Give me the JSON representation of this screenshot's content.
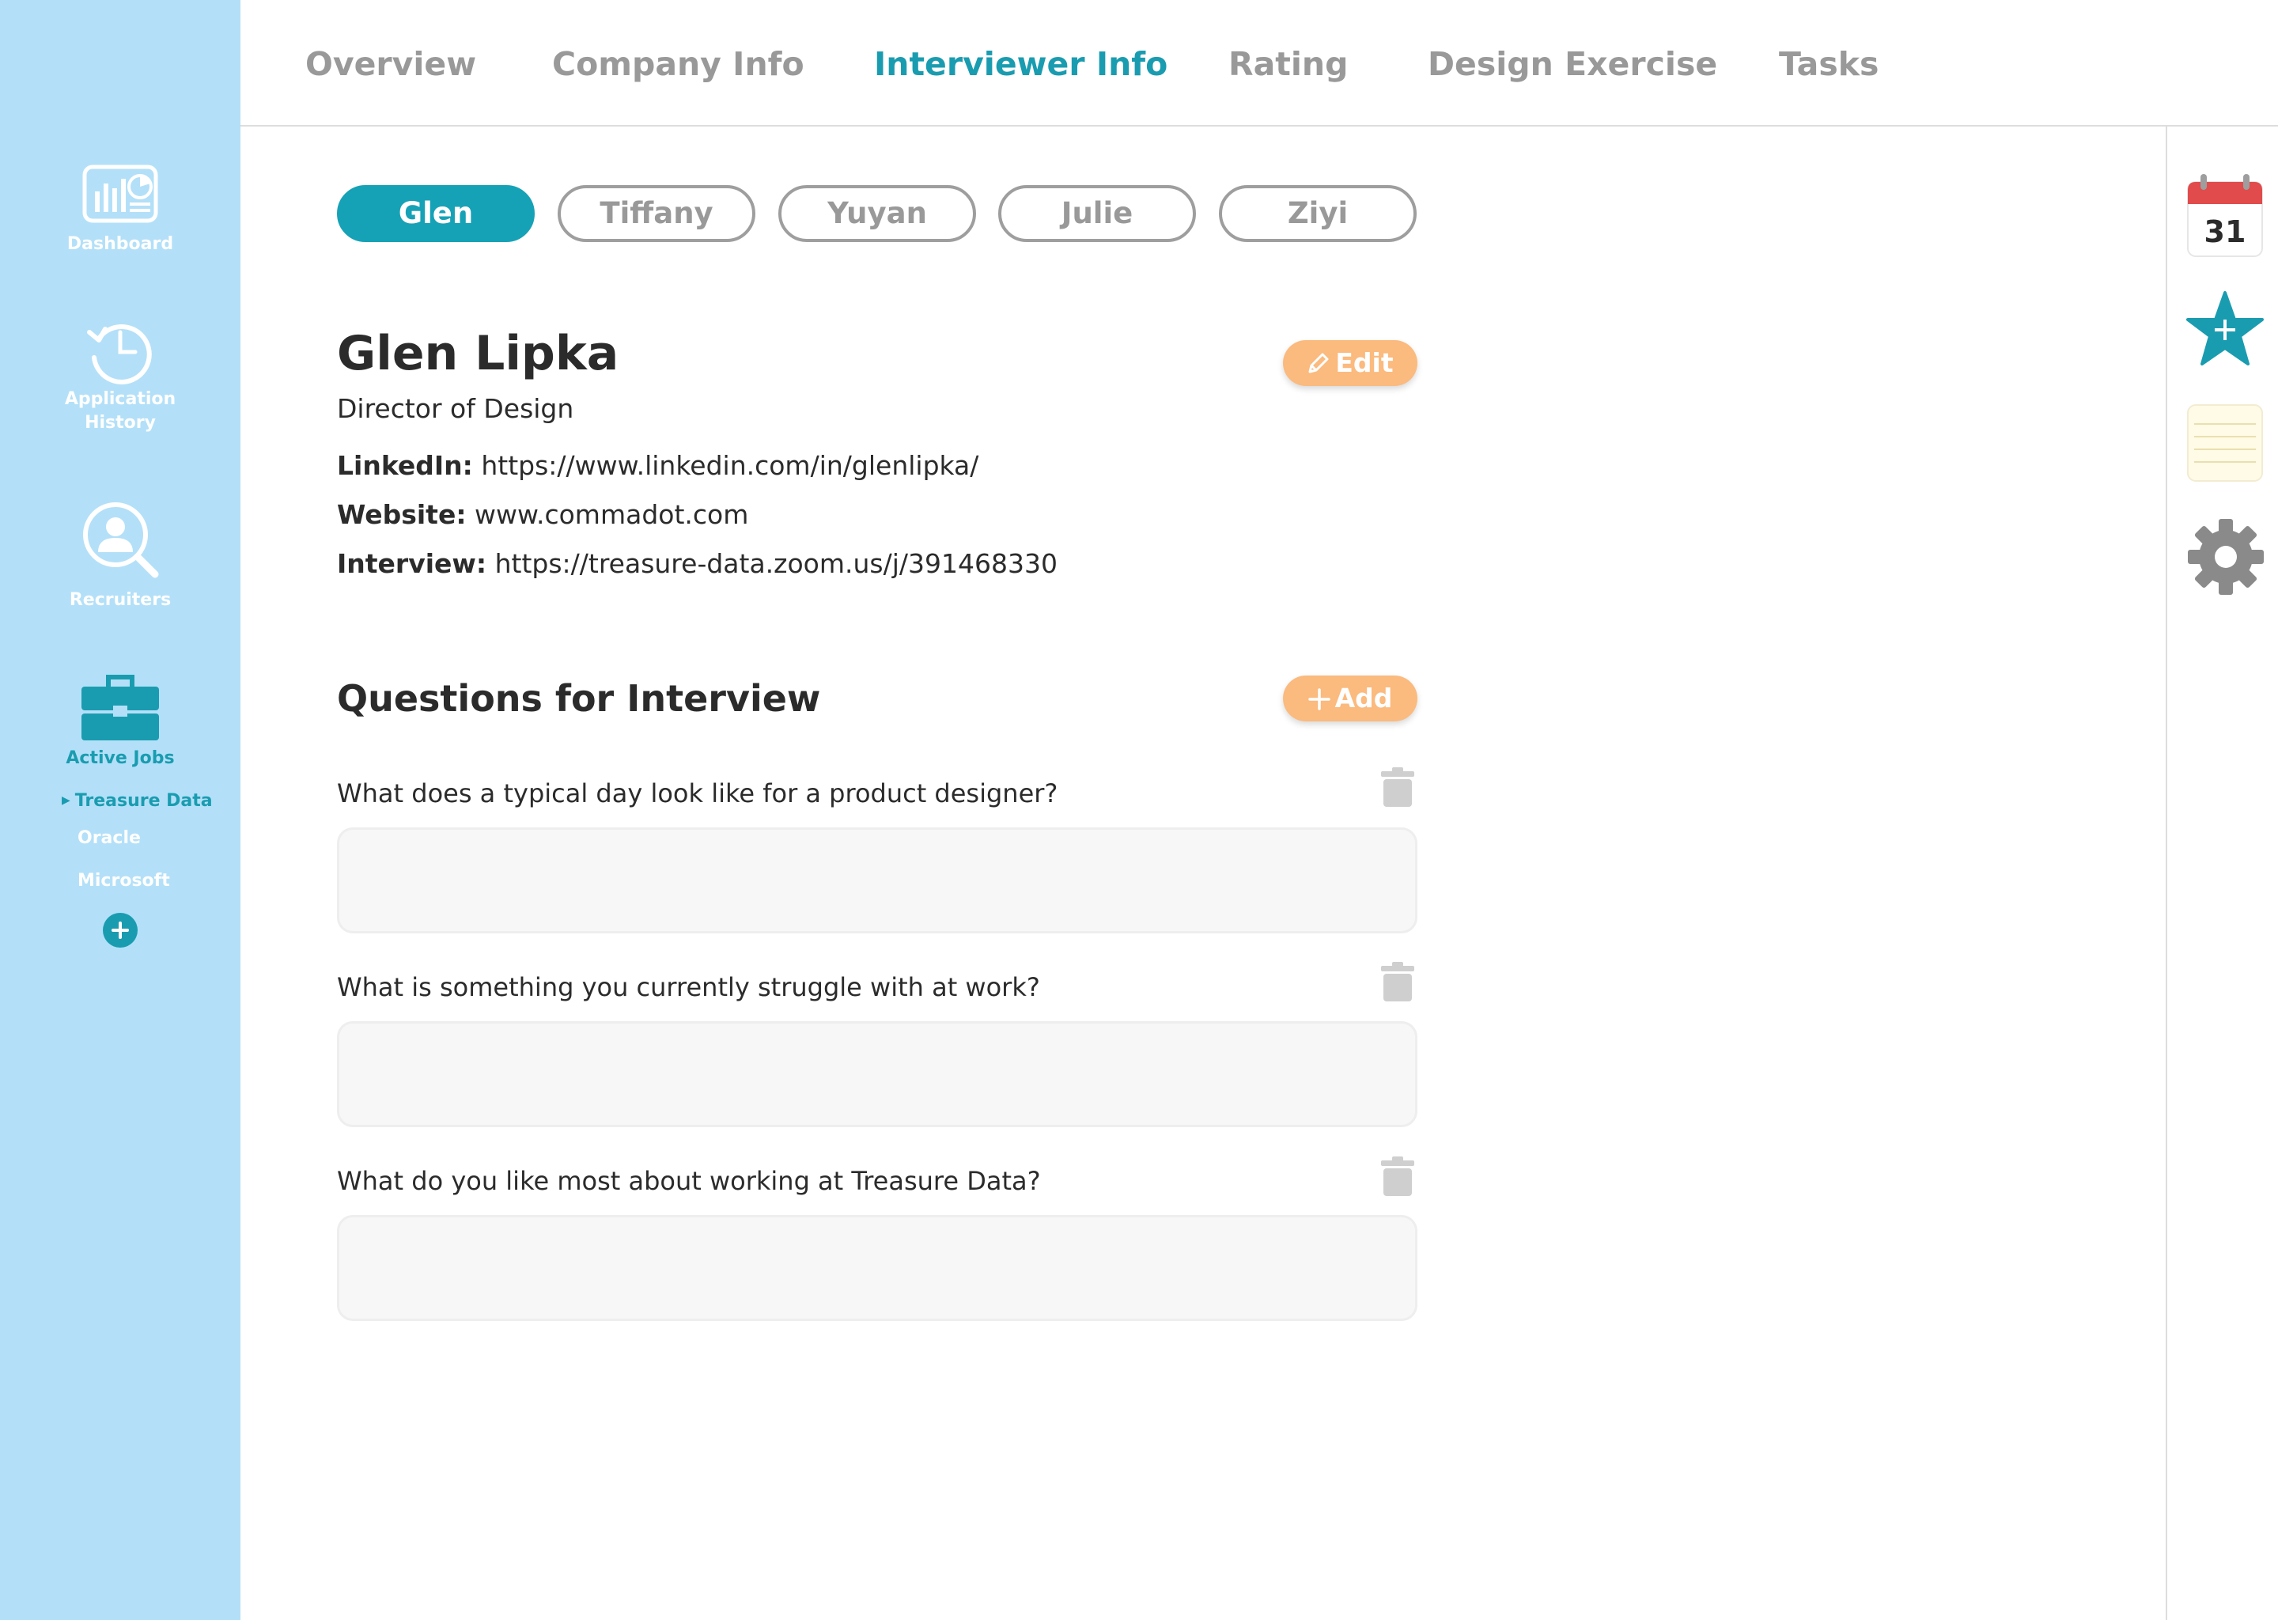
{
  "sidebar": {
    "items": [
      {
        "label": "Dashboard",
        "icon": "dashboard-chart-icon"
      },
      {
        "label": "Application History",
        "icon": "history-clock-icon"
      },
      {
        "label": "Recruiters",
        "icon": "person-search-icon"
      },
      {
        "label": "Active Jobs",
        "icon": "briefcase-icon"
      }
    ],
    "jobs": [
      {
        "label": "Treasure Data",
        "active": true
      },
      {
        "label": "Oracle",
        "active": false
      },
      {
        "label": "Microsoft",
        "active": false
      }
    ],
    "add_icon": "plus-circle-icon"
  },
  "tabs": [
    {
      "label": "Overview",
      "active": false
    },
    {
      "label": "Company Info",
      "active": false
    },
    {
      "label": "Interviewer Info",
      "active": true
    },
    {
      "label": "Rating",
      "active": false
    },
    {
      "label": "Design Exercise",
      "active": false
    },
    {
      "label": "Tasks",
      "active": false
    }
  ],
  "right_rail": {
    "calendar_day": "31",
    "icons": [
      "calendar-icon",
      "star-add-icon",
      "notepad-icon",
      "settings-gear-icon"
    ]
  },
  "interviewers": [
    "Glen",
    "Tiffany",
    "Yuyan",
    "Julie",
    "Ziyi"
  ],
  "active_interviewer": "Glen",
  "profile": {
    "name": "Glen Lipka",
    "title": "Director of Design",
    "edit_label": "Edit",
    "fields": [
      {
        "label": "LinkedIn:",
        "value": "https://www.linkedin.com/in/glenlipka/"
      },
      {
        "label": "Website:",
        "value": "www.commadot.com"
      },
      {
        "label": "Interview:",
        "value": "https://treasure-data.zoom.us/j/391468330"
      }
    ]
  },
  "questions_section": {
    "title": "Questions for Interview",
    "add_label": "Add",
    "questions": [
      {
        "text": "What does a typical day look like for a product designer?",
        "answer": ""
      },
      {
        "text": "What is something you currently struggle with at work?",
        "answer": ""
      },
      {
        "text": "What do you like most about working at Treasure Data?",
        "answer": ""
      }
    ]
  },
  "colors": {
    "sidebar_bg": "#b3e0f8",
    "accent_teal": "#1a9cb0",
    "orange_button": "#fbba7e",
    "inactive_text": "#999999",
    "calendar_red": "#e14b4b"
  }
}
